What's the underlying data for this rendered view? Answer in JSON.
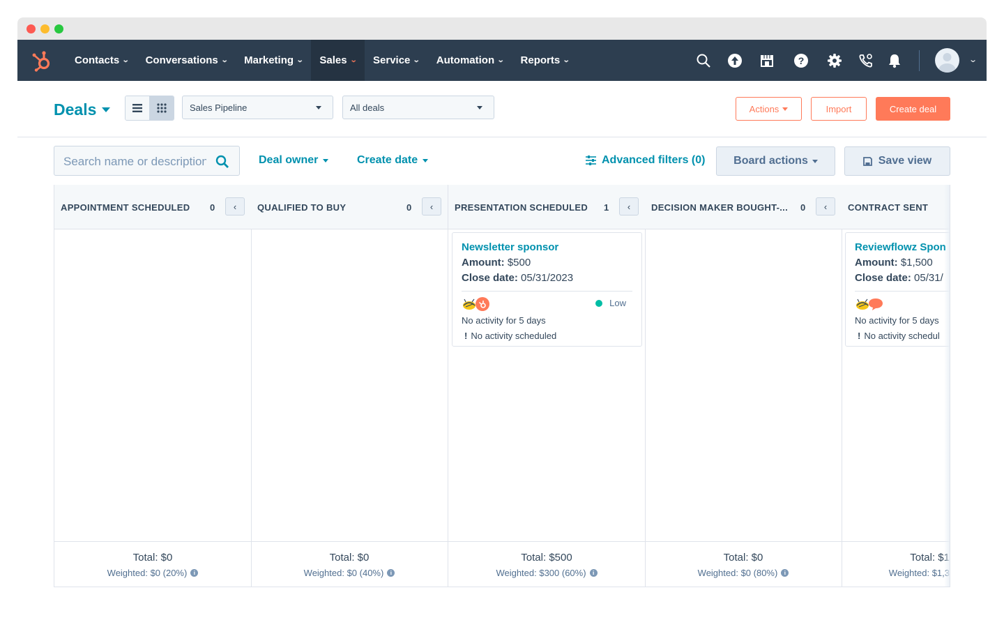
{
  "nav": {
    "items": [
      {
        "label": "Contacts"
      },
      {
        "label": "Conversations"
      },
      {
        "label": "Marketing"
      },
      {
        "label": "Sales"
      },
      {
        "label": "Service"
      },
      {
        "label": "Automation"
      },
      {
        "label": "Reports"
      }
    ],
    "active": "Sales",
    "icons": [
      "search-icon",
      "upgrade-icon",
      "marketplace-icon",
      "help-icon",
      "settings-icon",
      "calling-icon",
      "notifications-icon"
    ]
  },
  "header": {
    "title": "Deals",
    "pipeline_select": "Sales Pipeline",
    "view_select": "All deals",
    "actions_label": "Actions",
    "import_label": "Import",
    "create_label": "Create deal"
  },
  "filters": {
    "search_placeholder": "Search name or description",
    "deal_owner": "Deal owner",
    "create_date": "Create date",
    "advanced": "Advanced filters (0)",
    "board_actions": "Board actions",
    "save_view": "Save view"
  },
  "columns": [
    {
      "name": "APPOINTMENT SCHEDULED",
      "count": "0",
      "total": "Total: $0",
      "weighted": "Weighted: $0 (20%)"
    },
    {
      "name": "QUALIFIED TO BUY",
      "count": "0",
      "total": "Total: $0",
      "weighted": "Weighted: $0 (40%)"
    },
    {
      "name": "PRESENTATION SCHEDULED",
      "count": "1",
      "total": "Total: $500",
      "weighted": "Weighted: $300 (60%)",
      "card": {
        "name": "Newsletter sponsor",
        "amount_label": "Amount:",
        "amount": "$500",
        "close_label": "Close date:",
        "close_date": "05/31/2023",
        "priority": "Low",
        "activity": "No activity for 5 days",
        "scheduled": "No activity scheduled"
      }
    },
    {
      "name": "DECISION MAKER BOUGHT-...",
      "count": "0",
      "total": "Total: $0",
      "weighted": "Weighted: $0 (80%)"
    },
    {
      "name": "CONTRACT SENT",
      "count": "",
      "total": "Total: $1",
      "weighted": "Weighted: $1,3",
      "card": {
        "name": "Reviewflowz Spon",
        "amount_label": "Amount:",
        "amount": "$1,500",
        "close_label": "Close date:",
        "close_date": "05/31/",
        "activity": "No activity for 5 days",
        "scheduled": "No activity schedul"
      }
    }
  ],
  "colors": {
    "nav_bg": "#2d3e50",
    "accent": "#ff7a59",
    "link": "#0091ae",
    "priority_low": "#00bda5"
  }
}
